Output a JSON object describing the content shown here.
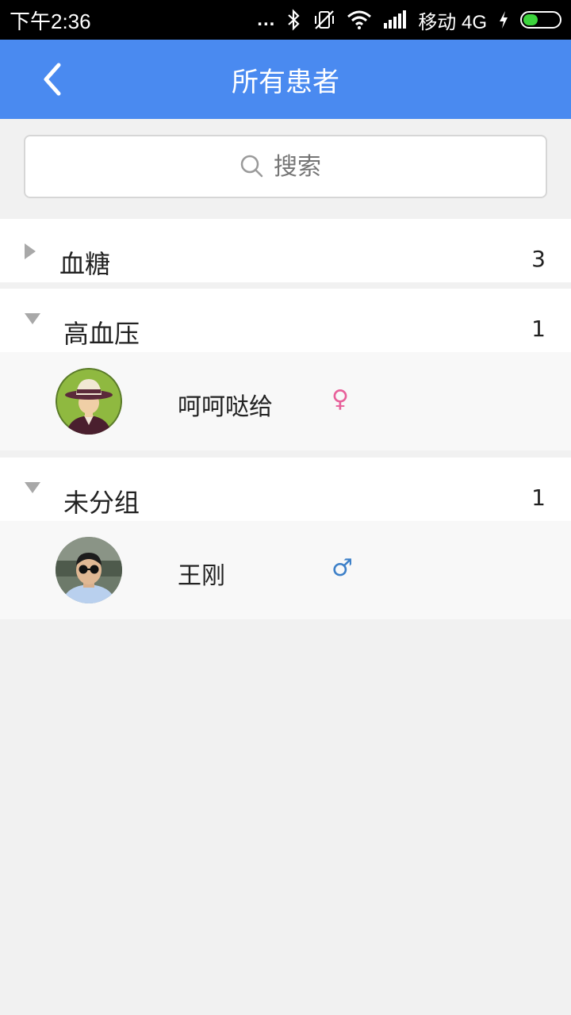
{
  "status_bar": {
    "time": "下午2:36",
    "dots": "...",
    "carrier": "移动 4G",
    "icons": [
      "bluetooth-icon",
      "vibrate-off-icon",
      "wifi-icon",
      "signal-icon",
      "charging-icon",
      "battery-icon"
    ]
  },
  "header": {
    "title": "所有患者",
    "back_icon": "chevron-left-icon"
  },
  "search": {
    "placeholder": "搜索",
    "icon": "search-icon"
  },
  "groups": [
    {
      "name": "血糖",
      "count": "3",
      "expanded": false,
      "patients": []
    },
    {
      "name": "高血压",
      "count": "1",
      "expanded": true,
      "patients": [
        {
          "name": "呵呵哒给",
          "gender": "♀",
          "gender_color": "#e8609a",
          "avatar": "cartoon-hat-avatar"
        }
      ]
    },
    {
      "name": "未分组",
      "count": "1",
      "expanded": true,
      "patients": [
        {
          "name": "王刚",
          "gender": "♂",
          "gender_color": "#3d80c8",
          "avatar": "photo-avatar"
        }
      ]
    }
  ],
  "colors": {
    "accent": "#4a8af0",
    "background": "#f1f1f1"
  }
}
